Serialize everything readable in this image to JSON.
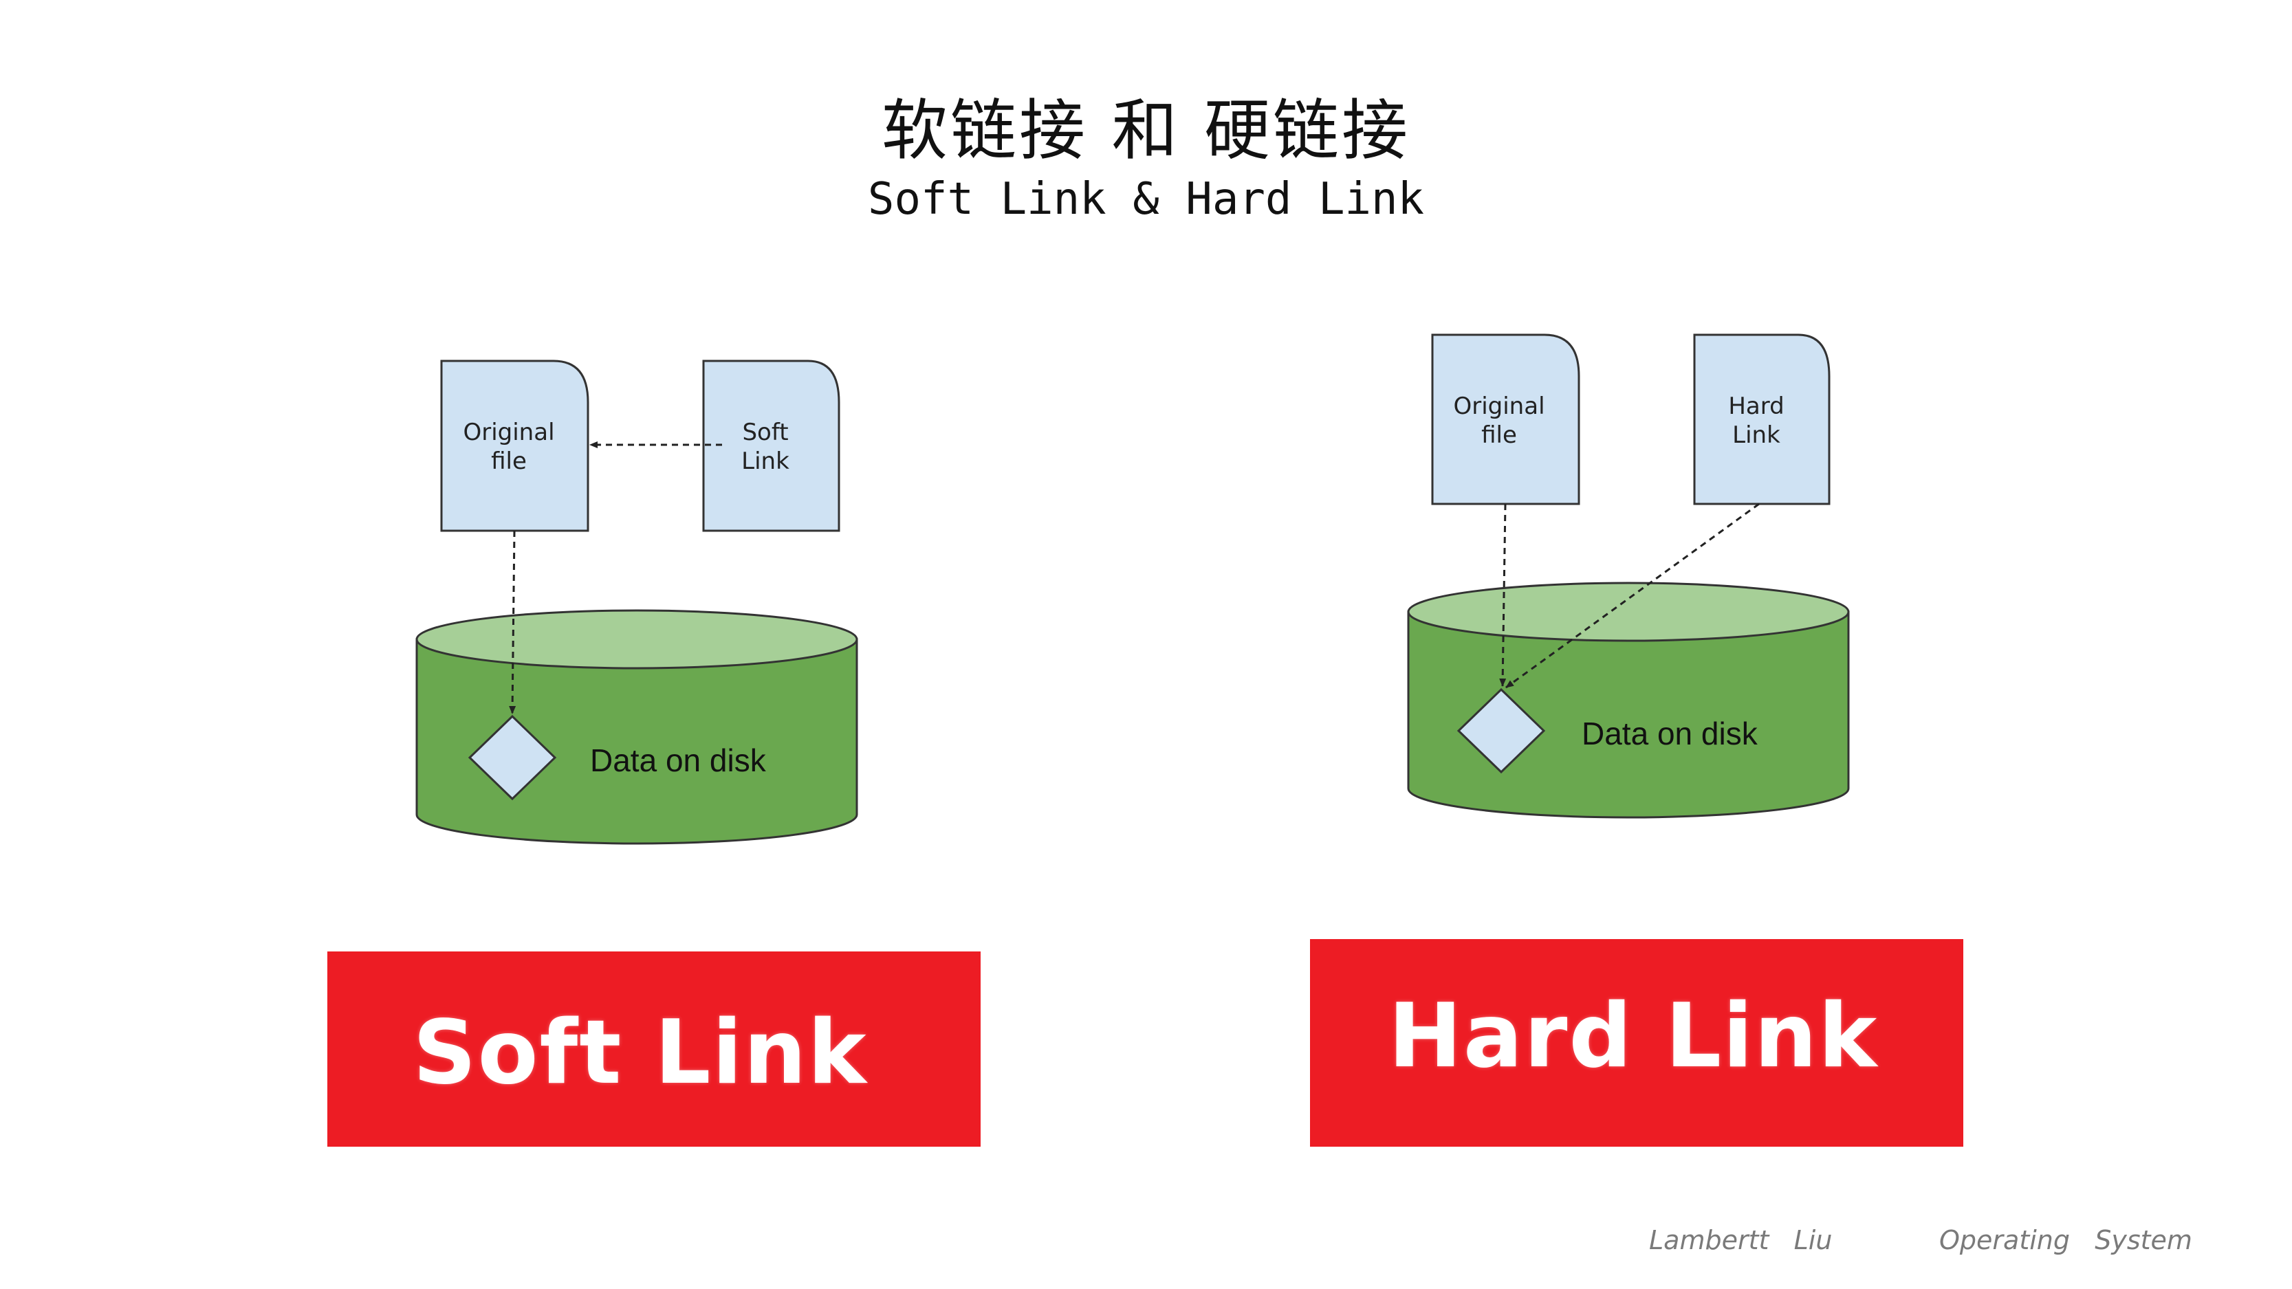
{
  "title": {
    "chinese": "软链接 和 硬链接",
    "english": "Soft Link & Hard Link"
  },
  "soft_link_diagram": {
    "original_file_label": [
      "Original",
      "file"
    ],
    "link_file_label": [
      "Soft",
      "Link"
    ],
    "disk_label": "Data on disk"
  },
  "hard_link_diagram": {
    "original_file_label": [
      "Original",
      "file"
    ],
    "link_file_label": [
      "Hard",
      "Link"
    ],
    "disk_label": "Data on disk"
  },
  "banners": {
    "soft": "Soft Link",
    "hard": "Hard Link"
  },
  "footer": {
    "author": "Lambertt   Liu",
    "course": "Operating   System"
  },
  "colors": {
    "file_fill": "#cfe2f3",
    "disk_body": "#6aa84f",
    "disk_top": "#a6cf97",
    "banner": "#ed1c24"
  }
}
